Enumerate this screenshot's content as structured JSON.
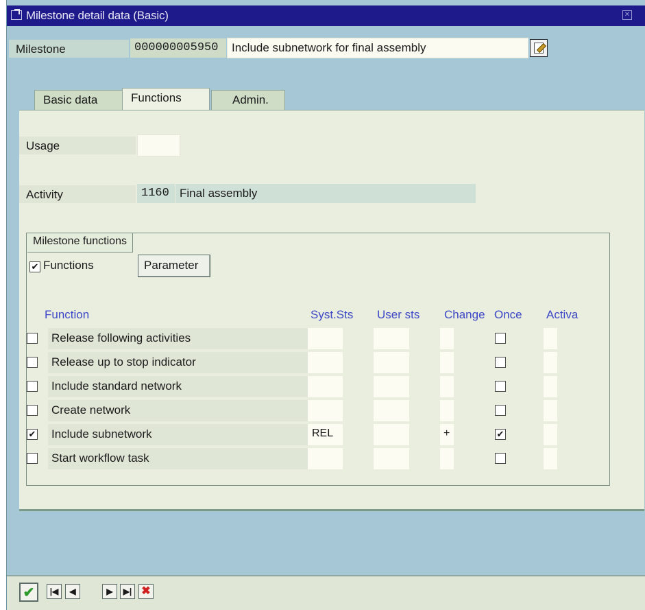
{
  "window": {
    "title": "Milestone detail data (Basic)"
  },
  "milestone": {
    "label": "Milestone",
    "number": "000000005950",
    "description": "Include subnetwork for final assembly"
  },
  "tabs": [
    {
      "label": "Basic data",
      "active": false
    },
    {
      "label": "Functions",
      "active": true
    },
    {
      "label": "Admin.",
      "active": false
    }
  ],
  "functions_tab": {
    "usage": {
      "label": "Usage",
      "value": ""
    },
    "activity": {
      "label": "Activity",
      "number": "1160",
      "description": "Final assembly"
    }
  },
  "milestone_functions": {
    "group_title": "Milestone functions",
    "functions_checkbox": {
      "label": "Functions",
      "checked": true
    },
    "parameter_button": "Parameter",
    "columns": {
      "function": "Function",
      "syst_sts": "Syst.Sts",
      "user_sts": "User sts",
      "change": "Change",
      "once": "Once",
      "activa": "Activa"
    },
    "rows": [
      {
        "label": "Release following activities",
        "checked": false,
        "syst_sts": "",
        "user_sts": "",
        "change": "",
        "once": false
      },
      {
        "label": "Release up to stop indicator",
        "checked": false,
        "syst_sts": "",
        "user_sts": "",
        "change": "",
        "once": false
      },
      {
        "label": "Include standard network",
        "checked": false,
        "syst_sts": "",
        "user_sts": "",
        "change": "",
        "once": false
      },
      {
        "label": "Create network",
        "checked": false,
        "syst_sts": "",
        "user_sts": "",
        "change": "",
        "once": false
      },
      {
        "label": "Include subnetwork",
        "checked": true,
        "syst_sts": "REL",
        "user_sts": "",
        "change": "+",
        "once": true
      },
      {
        "label": "Start workflow task",
        "checked": false,
        "syst_sts": "",
        "user_sts": "",
        "change": "",
        "once": false
      }
    ]
  },
  "toolbar": {
    "icons": [
      "confirm-icon",
      "first-icon",
      "previous-icon",
      "next-icon",
      "last-icon",
      "cancel-icon"
    ],
    "colors": {
      "confirm": "#2e9a2e",
      "cancel": "#d02020"
    }
  },
  "colors": {
    "titlebar": "#1e1a8c",
    "background": "#a6c8d6",
    "panel": "#e9eedf",
    "column_header": "#3d47c8"
  }
}
